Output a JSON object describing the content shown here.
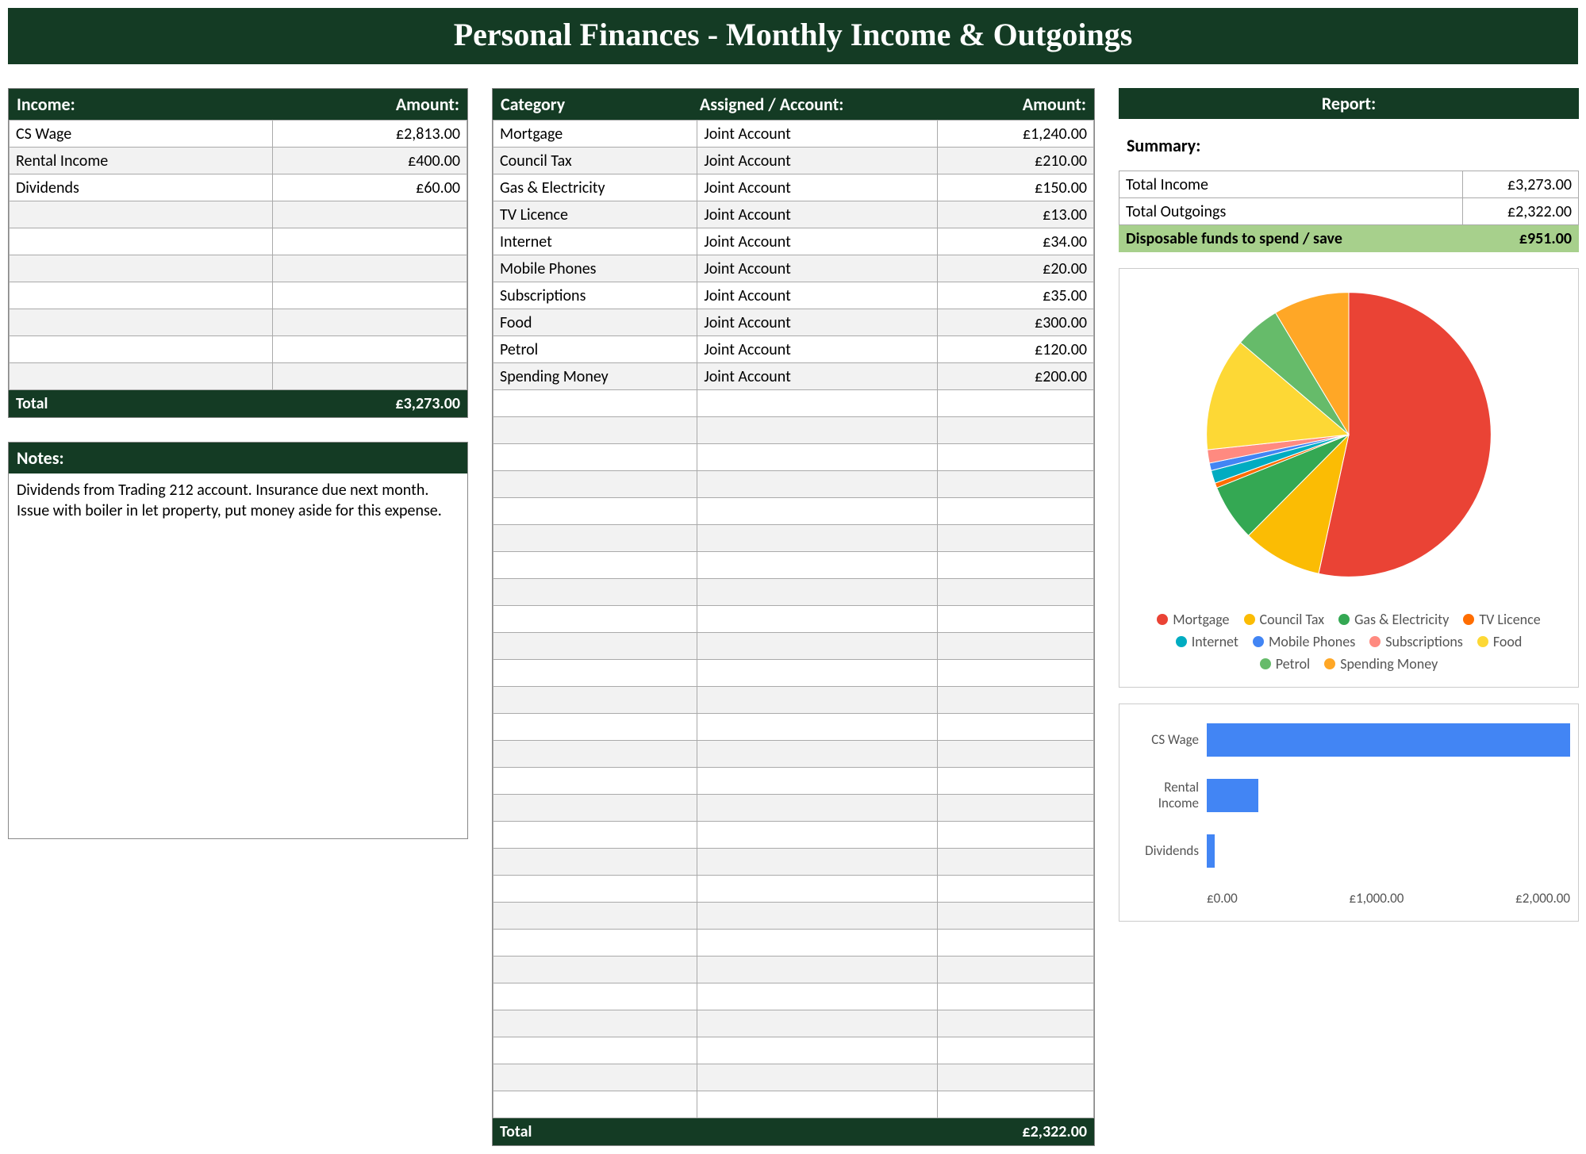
{
  "title": "Personal Finances - Monthly Income & Outgoings",
  "income": {
    "header_label": "Income:",
    "header_amount": "Amount:",
    "rows": [
      {
        "label": "CS Wage",
        "amount": "£2,813.00"
      },
      {
        "label": "Rental Income",
        "amount": "£400.00"
      },
      {
        "label": "Dividends",
        "amount": "£60.00"
      }
    ],
    "blank_rows": 7,
    "total_label": "Total",
    "total_amount": "£3,273.00"
  },
  "notes": {
    "header": "Notes:",
    "body": "Dividends from Trading 212 account. Insurance due next month. Issue with boiler in let property, put money aside for this expense."
  },
  "outgoings": {
    "header_category": "Category",
    "header_assigned": "Assigned / Account:",
    "header_amount": "Amount:",
    "rows": [
      {
        "category": "Mortgage",
        "assigned": "Joint Account",
        "amount": "£1,240.00"
      },
      {
        "category": "Council Tax",
        "assigned": "Joint Account",
        "amount": "£210.00"
      },
      {
        "category": "Gas & Electricity",
        "assigned": "Joint Account",
        "amount": "£150.00"
      },
      {
        "category": "TV Licence",
        "assigned": "Joint Account",
        "amount": "£13.00"
      },
      {
        "category": "Internet",
        "assigned": "Joint Account",
        "amount": "£34.00"
      },
      {
        "category": "Mobile Phones",
        "assigned": "Joint Account",
        "amount": "£20.00"
      },
      {
        "category": "Subscriptions",
        "assigned": "Joint Account",
        "amount": "£35.00"
      },
      {
        "category": "Food",
        "assigned": "Joint Account",
        "amount": "£300.00"
      },
      {
        "category": "Petrol",
        "assigned": "Joint Account",
        "amount": "£120.00"
      },
      {
        "category": "Spending Money",
        "assigned": "Joint Account",
        "amount": "£200.00"
      }
    ],
    "blank_rows": 27,
    "total_label": "Total",
    "total_amount": "£2,322.00"
  },
  "report": {
    "header": "Report:",
    "summary_label": "Summary:",
    "rows": [
      {
        "label": "Total Income",
        "amount": "£3,273.00"
      },
      {
        "label": "Total Outgoings",
        "amount": "£2,322.00"
      }
    ],
    "highlight": {
      "label": "Disposable funds to spend / save",
      "amount": "£951.00"
    }
  },
  "chart_data": [
    {
      "type": "pie",
      "title": "",
      "categories": [
        "Mortgage",
        "Council Tax",
        "Gas & Electricity",
        "TV Licence",
        "Internet",
        "Mobile Phones",
        "Subscriptions",
        "Food",
        "Petrol",
        "Spending Money"
      ],
      "values": [
        1240,
        210,
        150,
        13,
        34,
        20,
        35,
        300,
        120,
        200
      ],
      "colors": [
        "#ea4335",
        "#fbbc04",
        "#34a853",
        "#ff6d00",
        "#00acc1",
        "#4285f4",
        "#ff8a80",
        "#fdd835",
        "#66bb6a",
        "#ffa726"
      ]
    },
    {
      "type": "bar",
      "orientation": "horizontal",
      "categories": [
        "CS Wage",
        "Rental Income",
        "Dividends"
      ],
      "values": [
        2813,
        400,
        60
      ],
      "xlim": [
        0,
        2813
      ],
      "ticks": [
        "£0.00",
        "£1,000.00",
        "£2,000.00"
      ],
      "color": "#4285f4"
    }
  ]
}
